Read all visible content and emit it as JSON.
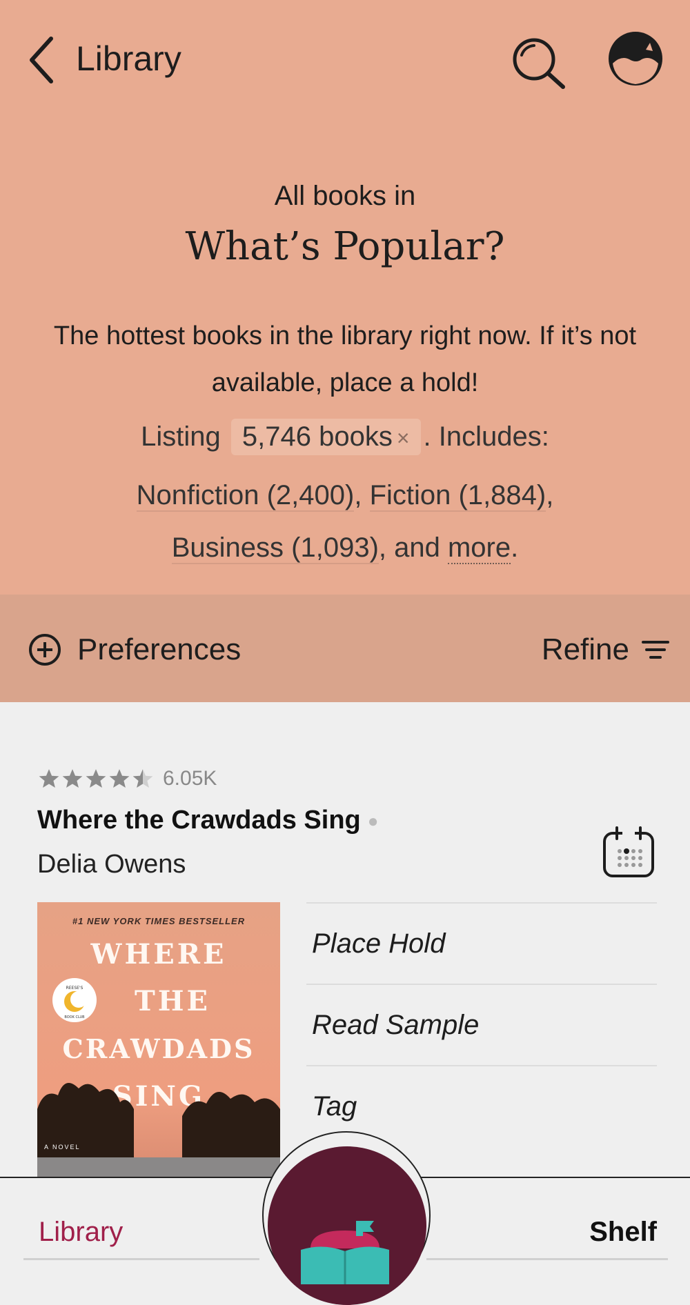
{
  "header": {
    "back_label": "Library",
    "icons": [
      "chevron-left-icon",
      "search-icon",
      "avatar-icon"
    ]
  },
  "hero": {
    "kicker": "All books in",
    "title": "What’s Popular?",
    "description": "The hottest books in the library right now. If it’s not available, place a hold!",
    "listing_prefix": "Listing",
    "listing_count": "5,746 books",
    "listing_clear": "×",
    "listing_suffix": ". Includes:",
    "categories": [
      {
        "label": "Nonfiction (2,400)"
      },
      {
        "label": "Fiction (1,884)"
      },
      {
        "label": "Business (1,093)"
      }
    ],
    "and_text": ", and",
    "more_label": "more"
  },
  "toolbar": {
    "preferences_label": "Preferences",
    "refine_label": "Refine"
  },
  "book": {
    "rating_stars": 4.5,
    "rating_count": "6.05K",
    "title": "Where the Crawdads Sing",
    "author": "Delia Owens",
    "cover": {
      "top_text": "#1 NEW YORK TIMES BESTSELLER",
      "lines": [
        "WHERE",
        "THE",
        "CRAWDADS",
        "SING"
      ],
      "subtitle": "A NOVEL",
      "seal_top": "REESE'S",
      "seal_bottom": "BOOK CLUB"
    },
    "actions": [
      {
        "label": "Place Hold"
      },
      {
        "label": "Read Sample"
      },
      {
        "label": "Tag"
      }
    ]
  },
  "bottom_nav": {
    "library_label": "Library",
    "shelf_label": "Shelf"
  },
  "colors": {
    "hero_bg": "#e8ab91",
    "prefbar_bg": "#d9a48c",
    "active_tab": "#a0204a",
    "fab_bg": "#5a1a31",
    "fab_book": "#3bbcb4"
  }
}
